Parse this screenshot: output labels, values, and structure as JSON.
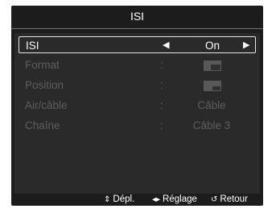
{
  "header": {
    "title": "ISI"
  },
  "menu": {
    "rows": [
      {
        "label": "ISI",
        "value": "On",
        "arrow_left": "◀",
        "arrow_right": "▶"
      },
      {
        "label": "Format",
        "colon": ":",
        "icon": "format-picture-icon"
      },
      {
        "label": "Position",
        "colon": ":",
        "icon": "position-picture-icon"
      },
      {
        "label": "Air/câble",
        "colon": ":",
        "value": "Câble"
      },
      {
        "label": "Chaîne",
        "colon": ":",
        "value": "Câble 3"
      }
    ]
  },
  "footer": {
    "move_icon": "⇕",
    "move_label": "Dépl.",
    "adjust_icon": "◂▸",
    "adjust_label": "Réglage",
    "return_icon": "↺",
    "return_label": "Retour"
  },
  "colors": {
    "background": "#1c1c1c",
    "panel": "#2a2a2a",
    "disabled_text": "#5d5d5d",
    "highlight_border": "#e6e6e6"
  }
}
